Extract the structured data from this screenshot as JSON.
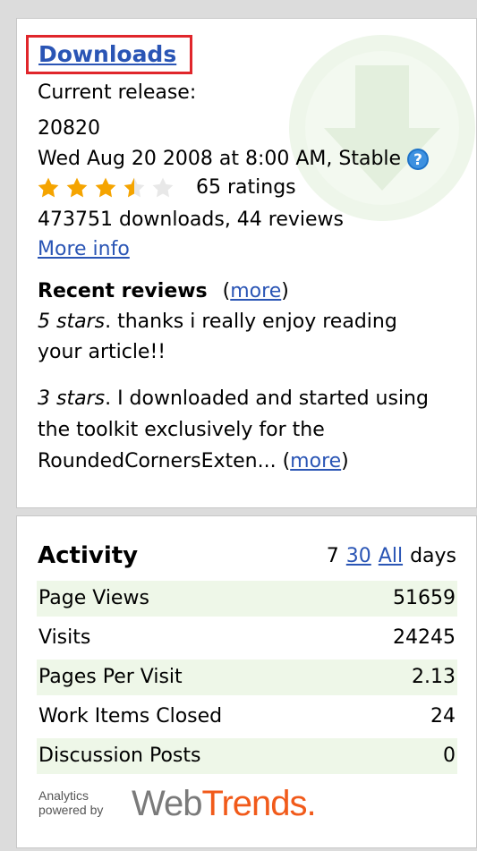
{
  "downloads": {
    "title": "Downloads",
    "current_release_label": "Current release:",
    "release_number": "20820",
    "release_date": "Wed Aug 20 2008 at 8:00 AM, Stable",
    "rating_value": 3.5,
    "rating_max": 5,
    "ratings_count": "65 ratings",
    "downloads_reviews": "473751 downloads, 44 reviews",
    "more_info": "More info",
    "recent_reviews_label": "Recent reviews",
    "more_label": "more",
    "reviews": [
      {
        "stars": "5 stars",
        "text_line1": ". thanks i really enjoy reading",
        "text_line2": "your article!!"
      },
      {
        "stars": "3 stars",
        "text_line1": ". I downloaded and started using",
        "text_line2": "the toolkit exclusively for the",
        "text_line3": "RoundedCornersExten... "
      }
    ]
  },
  "activity": {
    "title": "Activity",
    "days_7": "7",
    "days_30": "30",
    "days_all": "All",
    "days_label": "days",
    "rows": [
      {
        "label": "Page Views",
        "value": "51659"
      },
      {
        "label": "Visits",
        "value": "24245"
      },
      {
        "label": "Pages Per Visit",
        "value": "2.13"
      },
      {
        "label": "Work Items Closed",
        "value": "24"
      },
      {
        "label": "Discussion Posts",
        "value": "0"
      }
    ],
    "powered_line1": "Analytics",
    "powered_line2": "powered by",
    "brand_web": "Web",
    "brand_trends": "Trends."
  },
  "colors": {
    "link": "#2a55b5",
    "highlight_border": "#e0262b",
    "row_alt": "#eef7e8",
    "star": "#f5a400",
    "brand_orange": "#f15a1a"
  }
}
